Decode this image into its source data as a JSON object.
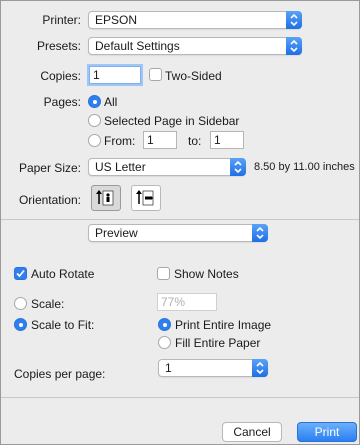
{
  "printer": {
    "label": "Printer:",
    "value": "EPSON"
  },
  "presets": {
    "label": "Presets:",
    "value": "Default Settings"
  },
  "copies": {
    "label": "Copies:",
    "value": "1",
    "two_sided_label": "Two-Sided",
    "two_sided_checked": false
  },
  "pages": {
    "label": "Pages:",
    "all_label": "All",
    "selected_sidebar_label": "Selected Page in Sidebar",
    "from_label": "From:",
    "from_value": "1",
    "to_label": "to:",
    "to_value": "1",
    "selected": "All"
  },
  "paper_size": {
    "label": "Paper Size:",
    "value": "US Letter",
    "dimensions": "8.50 by 11.00 inches"
  },
  "orientation": {
    "label": "Orientation:",
    "options": [
      "portrait",
      "landscape"
    ],
    "selected": "portrait"
  },
  "section_menu": {
    "value": "Preview"
  },
  "preview": {
    "auto_rotate_label": "Auto Rotate",
    "auto_rotate_checked": true,
    "show_notes_label": "Show Notes",
    "show_notes_checked": false,
    "scale_label": "Scale:",
    "scale_value": "77%",
    "scale_to_fit_label": "Scale to Fit:",
    "scale_mode": "Scale to Fit",
    "print_entire_image_label": "Print Entire Image",
    "fill_entire_paper_label": "Fill Entire Paper",
    "fit_mode": "Print Entire Image",
    "copies_per_page_label": "Copies per page:",
    "copies_per_page_value": "1"
  },
  "buttons": {
    "cancel_label": "Cancel",
    "print_label": "Print"
  },
  "colors": {
    "accent": "#2f7ff0",
    "background": "#ececec"
  }
}
